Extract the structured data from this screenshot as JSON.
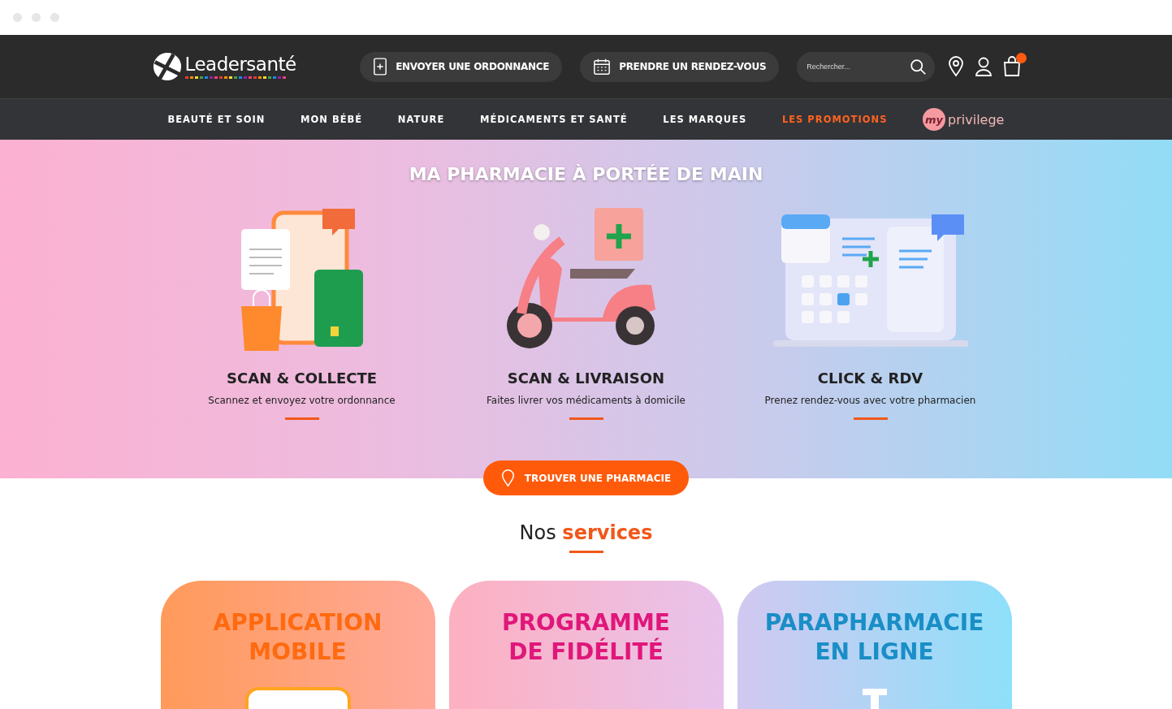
{
  "header": {
    "logo_text": "Leadersanté",
    "actions": [
      {
        "kind": "prescription",
        "label": "ENVOYER UNE ORDONNANCE"
      },
      {
        "kind": "calendar",
        "label": "PRENDRE UN RENDEZ-VOUS"
      }
    ],
    "search": {
      "placeholder": "Rechercher..."
    },
    "cart": {
      "has_items": true
    }
  },
  "nav": {
    "items": [
      {
        "label": "BEAUTÉ ET SOIN",
        "highlighted": false
      },
      {
        "label": "MON BÉBÉ",
        "highlighted": false
      },
      {
        "label": "NATURE",
        "highlighted": false
      },
      {
        "label": "MÉDICAMENTS ET SANTÉ",
        "highlighted": false
      },
      {
        "label": "LES MARQUES",
        "highlighted": false
      },
      {
        "label": "LES PROMOTIONS",
        "highlighted": true
      }
    ],
    "privilege": {
      "badge": "my",
      "label": "privilege"
    }
  },
  "hero": {
    "title": "MA PHARMACIE À PORTÉE DE MAIN",
    "features": [
      {
        "kind": "collect",
        "title": "SCAN & COLLECTE",
        "text": "Scannez et envoyez votre ordonnance"
      },
      {
        "kind": "delivery",
        "title": "SCAN & LIVRAISON",
        "text": "Faites livrer vos médicaments à domicile"
      },
      {
        "kind": "appointment",
        "title": "CLICK & RDV",
        "text": "Prenez rendez-vous avec votre pharmacien"
      }
    ],
    "button": "TROUVER UNE PHARMACIE"
  },
  "services": {
    "title": "Nos **services**",
    "cards": [
      {
        "kind": "app",
        "title": "APPLICATION MOBILE"
      },
      {
        "kind": "loyalty",
        "title": "PROGRAMME DE FIDÉLITÉ"
      },
      {
        "kind": "shop",
        "title": "PARAPHARMACIE EN LIGNE"
      }
    ]
  }
}
